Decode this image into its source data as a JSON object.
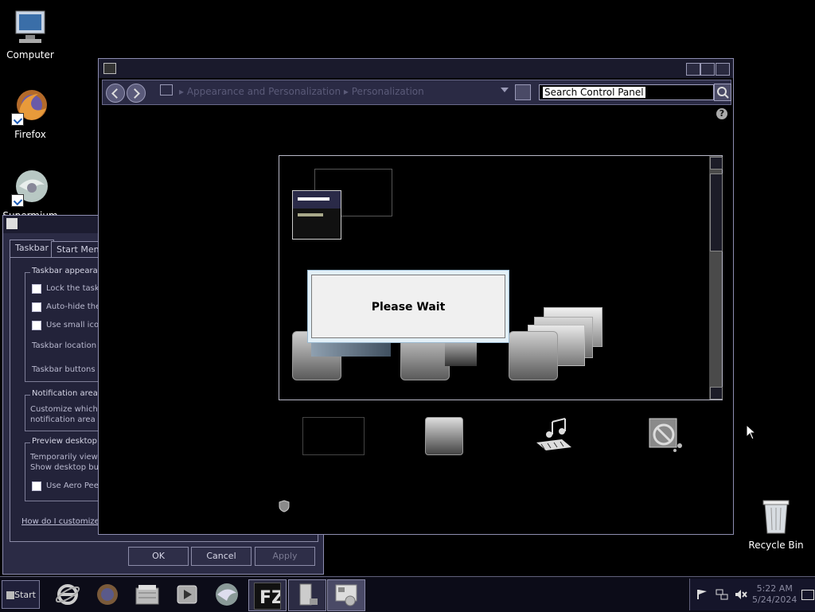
{
  "desktop": {
    "icons": [
      {
        "label": "Computer",
        "icon": "computer-icon"
      },
      {
        "label": "Firefox",
        "icon": "firefox-icon"
      },
      {
        "label": "Supermium",
        "icon": "supermium-icon"
      },
      {
        "label": "Recycle Bin",
        "icon": "recycle-bin-icon"
      }
    ]
  },
  "cp_window": {
    "breadcrumb": [
      "Appearance and Personalization",
      "Personalization"
    ],
    "search_placeholder": "Search Control Panel",
    "help_label": "?",
    "dialog_text": "Please Wait"
  },
  "taskbar_props": {
    "tabs": [
      "Taskbar",
      "Start Menu"
    ],
    "group_appearance": "Taskbar appearance",
    "options": [
      "Lock the taskbar",
      "Auto-hide the taskbar",
      "Use small icons"
    ],
    "location_label": "Taskbar location on screen",
    "buttons_label": "Taskbar buttons",
    "group_notification": "Notification area",
    "notification_desc_1": "Customize which icons and",
    "notification_desc_2": "notification area",
    "group_preview": "Preview desktop with Aero Peek",
    "preview_desc_1": "Temporarily view the desktop",
    "preview_desc_2": "Show desktop button",
    "aero_peek": "Use Aero Peek",
    "customize_link": "How do I customize",
    "ok": "OK",
    "cancel": "Cancel",
    "apply": "Apply"
  },
  "taskbar": {
    "start_label": "Start",
    "clock_time": "5:22 AM",
    "clock_date": "5/24/2024"
  }
}
